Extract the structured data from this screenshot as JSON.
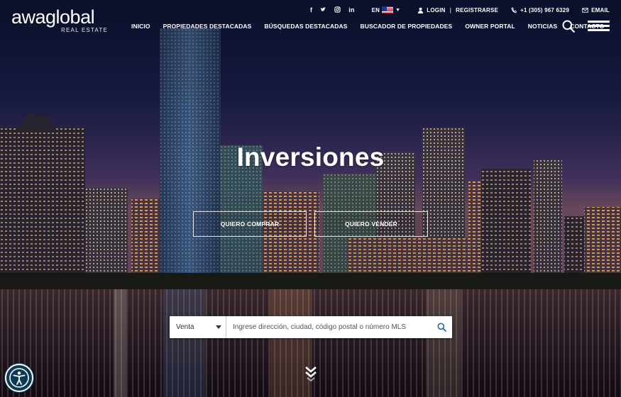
{
  "brand": {
    "logo_word": "awaglobal",
    "logo_sub": "REAL ESTATE"
  },
  "topbar": {
    "social": [
      {
        "icon": "facebook-icon",
        "glyph": "f"
      },
      {
        "icon": "twitter-icon",
        "glyph": "ᴛ"
      },
      {
        "icon": "instagram-icon",
        "glyph": "◎"
      },
      {
        "icon": "linkedin-icon",
        "glyph": "in"
      }
    ],
    "language": "EN",
    "login": "LOGIN",
    "register": "REGISTRARSE",
    "phone": "+1 (305) 967 6329",
    "email": "EMAIL"
  },
  "nav": {
    "items": [
      "INICIO",
      "PROPIEDADES DESTACADAS",
      "BÚSQUEDAS DESTACADAS",
      "BUSCADOR DE PROPIEDADES",
      "OWNER PORTAL",
      "NOTICIAS",
      "CONTACTO"
    ]
  },
  "hero": {
    "title": "Inversiones",
    "buy_label": "QUIERO COMPRAR",
    "sell_label": "QUIERO VENDER"
  },
  "search": {
    "type_value": "Venta",
    "placeholder": "Ingrese dirección, ciudad, código postal o número MLS"
  },
  "colors": {
    "accent": "#1f6f9a",
    "a11y_bg": "#0c3b57"
  }
}
